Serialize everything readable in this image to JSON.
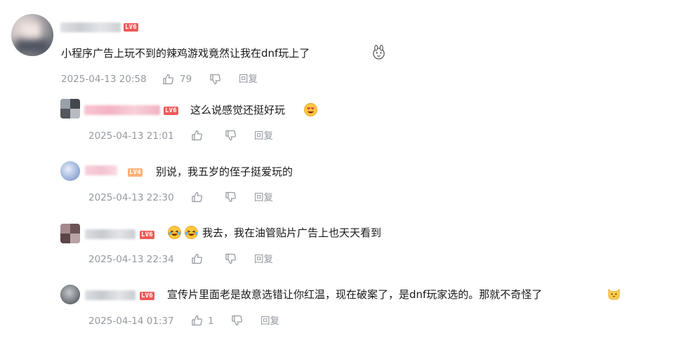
{
  "colors": {
    "text": "#18191c",
    "meta": "#9499a0",
    "lv6_badge": "#ef5a5a",
    "lv4_badge": "#ffb27a"
  },
  "main_comment": {
    "level_badge": "LV6",
    "content": "小程序广告上玩不到的辣鸡游戏竟然让我在dnf玩上了",
    "emoji": "rabbit-face-emoji",
    "timestamp": "2025-04-13 20:58",
    "like_count": "79",
    "reply_label": "回复"
  },
  "replies": [
    {
      "level_badge": "LV6",
      "content": "这么说感觉还挺好玩",
      "emoji": "heart-eyes-emoji",
      "timestamp": "2025-04-13 21:01",
      "like_count": "",
      "reply_label": "回复"
    },
    {
      "level_badge": "LV4",
      "content": "别说，我五岁的侄子挺爱玩的",
      "timestamp": "2025-04-13 22:30",
      "like_count": "",
      "reply_label": "回复"
    },
    {
      "level_badge": "LV6",
      "content": "我去，我在油管贴片广告上也天天看到",
      "emoji": "crying-laughing-emoji",
      "timestamp": "2025-04-13 22:34",
      "like_count": "",
      "reply_label": "回复"
    },
    {
      "level_badge": "LV6",
      "content": "宣传片里面老是故意选错让你红温，现在破案了，是dnf玩家选的。那就不奇怪了",
      "emoji": "cat-face-emoji",
      "timestamp": "2025-04-14 01:37",
      "like_count": "1",
      "reply_label": "回复"
    }
  ]
}
